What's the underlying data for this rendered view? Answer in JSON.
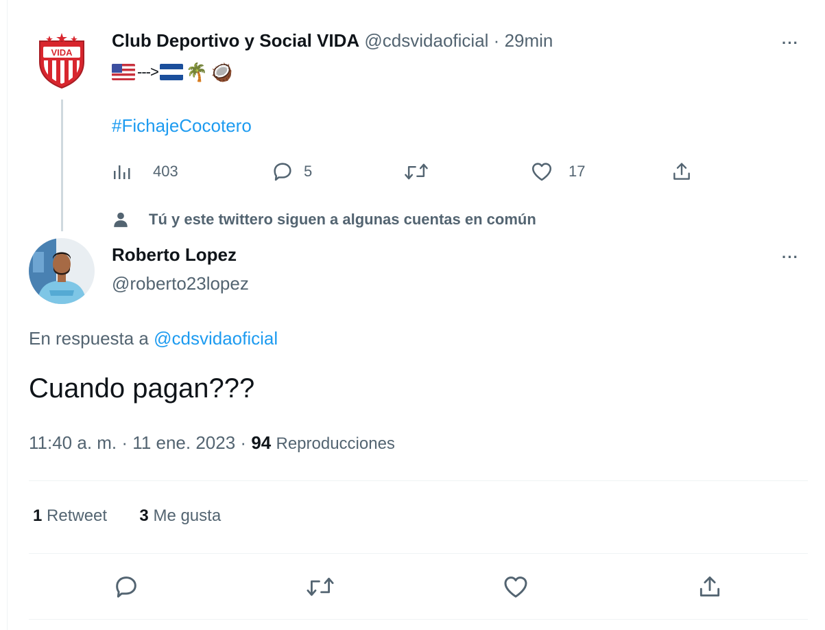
{
  "parent_tweet": {
    "author_name": "Club Deportivo y Social VIDA",
    "handle": "@cdsvidaoficial",
    "separator": "·",
    "time": "29min",
    "avatar_text": "VIDA",
    "emoji_row": {
      "arrow": "--->",
      "palm": "🌴",
      "coconut": "🥥",
      "flag_from": "us-flag-icon",
      "flag_to": "honduras-flag-icon"
    },
    "hashtag": "#FichajeCocotero",
    "actions": {
      "views": "403",
      "replies": "5",
      "retweets": "",
      "likes": "17"
    }
  },
  "social_context": "Tú y este twittero siguen a algunas cuentas en común",
  "reply_tweet": {
    "author_name": "Roberto Lopez",
    "handle": "@roberto23lopez",
    "reply_to_prefix": "En respuesta a",
    "reply_to_mention": "@cdsvidaoficial",
    "text": "Cuando pagan???",
    "time": "11:40 a. m.",
    "sep1": "·",
    "date": "11 ene. 2023",
    "sep2": "·",
    "views_count": "94",
    "views_label": "Reproducciones",
    "retweets_count": "1",
    "retweets_label": "Retweet",
    "likes_count": "3",
    "likes_label": "Me gusta"
  },
  "more_label": "···",
  "colors": {
    "link": "#1d9bf0",
    "secondary_text": "#536471",
    "primary_text": "#0f1419",
    "club_red": "#d8262e"
  }
}
